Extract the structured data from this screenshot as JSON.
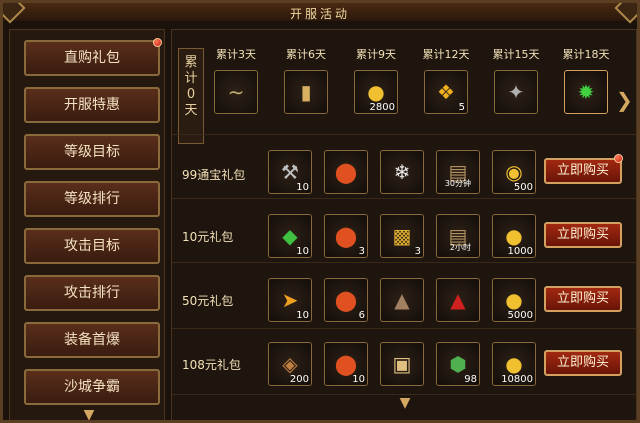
{
  "title": "开服活动",
  "sidebar": {
    "items": [
      {
        "label": "直购礼包",
        "active": true,
        "dot": true
      },
      {
        "label": "开服特惠",
        "active": false
      },
      {
        "label": "等级目标",
        "active": false
      },
      {
        "label": "等级排行",
        "active": false
      },
      {
        "label": "攻击目标",
        "active": false
      },
      {
        "label": "攻击排行",
        "active": false
      },
      {
        "label": "装备首爆",
        "active": false
      },
      {
        "label": "沙城争霸",
        "active": false
      }
    ]
  },
  "cumulative": {
    "label_line1": "累",
    "label_line2": "计",
    "days_value": "0",
    "days_unit": "天",
    "milestones": [
      {
        "label": "累计3天",
        "icon": "necklace-icon",
        "qty": ""
      },
      {
        "label": "累计6天",
        "icon": "scroll-icon",
        "qty": ""
      },
      {
        "label": "累计9天",
        "icon": "gold-ingot-icon",
        "qty": "2800"
      },
      {
        "label": "累计12天",
        "icon": "gold-nugget-icon",
        "qty": "5"
      },
      {
        "label": "累计15天",
        "icon": "armor-icon",
        "qty": ""
      },
      {
        "label": "累计18天",
        "icon": "green-orb-icon",
        "qty": ""
      }
    ]
  },
  "packs": [
    {
      "label": "99通宝礼包",
      "buy_label": "立即购买",
      "dot": true,
      "items": [
        {
          "icon": "axe-icon",
          "qty": "10"
        },
        {
          "icon": "red-pill-icon",
          "qty": ""
        },
        {
          "icon": "crystal-icon",
          "qty": ""
        },
        {
          "icon": "book-icon",
          "qty": "",
          "overlay": "30分钟"
        },
        {
          "icon": "gold-coins-icon",
          "qty": "500"
        }
      ]
    },
    {
      "label": "10元礼包",
      "buy_label": "立即购买",
      "items": [
        {
          "icon": "green-gem-icon",
          "qty": "10"
        },
        {
          "icon": "red-pill-icon",
          "qty": "3"
        },
        {
          "icon": "gold-bars-icon",
          "qty": "3"
        },
        {
          "icon": "book-icon",
          "qty": "",
          "overlay": "2小时"
        },
        {
          "icon": "gold-ingot-icon",
          "qty": "1000"
        }
      ]
    },
    {
      "label": "50元礼包",
      "buy_label": "立即购买",
      "items": [
        {
          "icon": "fire-scroll-icon",
          "qty": "10"
        },
        {
          "icon": "red-pill-icon",
          "qty": "6"
        },
        {
          "icon": "ore-icon",
          "qty": ""
        },
        {
          "icon": "red-ore-icon",
          "qty": ""
        },
        {
          "icon": "gold-ingot-icon",
          "qty": "5000"
        }
      ]
    },
    {
      "label": "108元礼包",
      "buy_label": "立即购买",
      "items": [
        {
          "icon": "shield-icon",
          "qty": "200"
        },
        {
          "icon": "red-pill-icon",
          "qty": "10"
        },
        {
          "icon": "parchment-icon",
          "qty": ""
        },
        {
          "icon": "jade-icon",
          "qty": "98"
        },
        {
          "icon": "gold-ingot-icon",
          "qty": "10800"
        }
      ]
    }
  ],
  "colors": {
    "accent_red": "#b02a0e",
    "gold_border": "#d4a060",
    "text_light": "#f2e0b6"
  }
}
